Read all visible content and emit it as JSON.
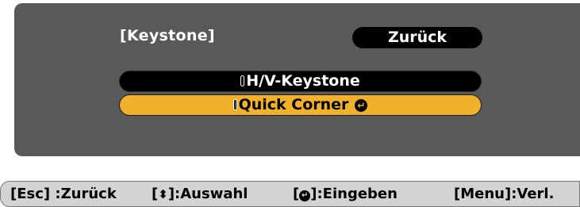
{
  "menu": {
    "title": "[Keystone]",
    "back_label": "Zurück",
    "options": [
      {
        "label": "H/V-Keystone",
        "selected": false
      },
      {
        "label": "Quick Corner",
        "selected": true
      }
    ]
  },
  "status_bar": {
    "esc_hint": "[Esc] :Zurück",
    "select_prefix": "[",
    "select_suffix": "]:Auswahl",
    "enter_prefix": "[",
    "enter_suffix": "]:Eingeben",
    "menu_hint": "[Menu]:Verl."
  },
  "icons": {
    "updown": "updown-arrow-icon",
    "enter": "enter-icon"
  },
  "colors": {
    "panel": "#595959",
    "highlight": "#f2b12a",
    "status_bar": "#d3d3d3"
  }
}
